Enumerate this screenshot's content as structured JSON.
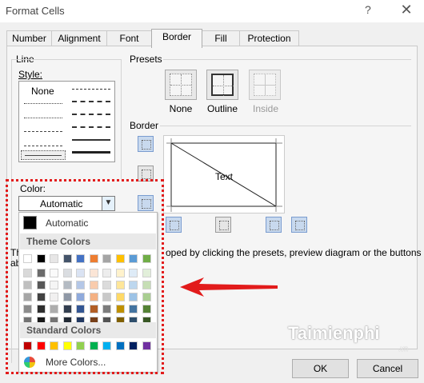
{
  "window": {
    "title": "Format Cells",
    "help": "?",
    "close": "✕"
  },
  "tabs": [
    "Number",
    "Alignment",
    "Font",
    "Border",
    "Fill",
    "Protection"
  ],
  "line": {
    "group": "Line",
    "style_label": "Style:",
    "none": "None"
  },
  "presets": {
    "group": "Presets",
    "none": "None",
    "outline": "Outline",
    "inside": "Inside"
  },
  "border": {
    "group": "Border",
    "preview_text": "Text"
  },
  "color": {
    "label": "Color:",
    "value": "Automatic",
    "automatic": "Automatic",
    "theme_header": "Theme Colors",
    "standard_header": "Standard Colors",
    "more": "More Colors...",
    "theme_columns": [
      "#ffffff",
      "#000000",
      "#e7e6e6",
      "#44546a",
      "#4472c4",
      "#ed7d31",
      "#a5a5a5",
      "#ffc000",
      "#5b9bd5",
      "#70ad47"
    ],
    "standard": [
      "#c00000",
      "#ff0000",
      "#ffc000",
      "#ffff00",
      "#92d050",
      "#00b050",
      "#00b0f0",
      "#0070c0",
      "#002060",
      "#7030a0"
    ]
  },
  "partial_text": {
    "left_t": "Th",
    "left_a": "ab",
    "right": "oped by clicking the presets, preview diagram or the buttons"
  },
  "buttons": {
    "ok": "OK",
    "cancel": "Cancel"
  },
  "watermark": {
    "brand": "Taimienphi",
    "tld": ".vn"
  },
  "accent": "#e21b1b"
}
